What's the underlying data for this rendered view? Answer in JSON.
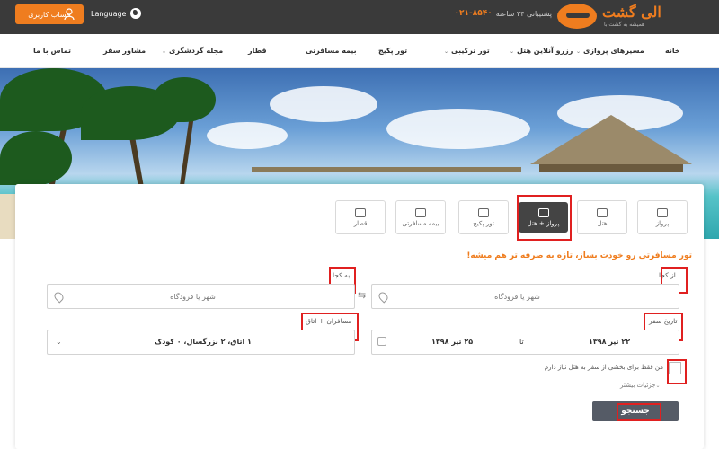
{
  "header": {
    "account_label": "حساب کاربری",
    "language_label": "Language",
    "support_label": "پشتیبانی ۲۴ ساعته",
    "phone": "۰۲۱-۸۵۴۰",
    "logo_name": "الی گشت",
    "logo_slogan": "همیشه به گشت با",
    "accent_color": "#ef7d1f",
    "bar_color": "#3a3a3a"
  },
  "nav": {
    "items": [
      {
        "label": "خانه"
      },
      {
        "label": "مسیرهای پروازی"
      },
      {
        "label": "رزرو آنلاین هتل"
      },
      {
        "label": "تور ترکیبی"
      },
      {
        "label": "تور پکیج"
      },
      {
        "label": "بیمه مسافرتی"
      },
      {
        "label": "قطار"
      },
      {
        "label": "مجله گردشگری"
      },
      {
        "label": "مشاور سفر"
      },
      {
        "label": "تماس با ما"
      }
    ]
  },
  "tabs": [
    {
      "label": "پرواز",
      "icon": "plane-icon"
    },
    {
      "label": "هتل",
      "icon": "hotel-icon"
    },
    {
      "label": "پرواز + هتل",
      "icon": "plane-hotel-icon",
      "active": true
    },
    {
      "label": "تور پکیج",
      "icon": "package-icon"
    },
    {
      "label": "بیمه مسافرتی",
      "icon": "umbrella-icon"
    },
    {
      "label": "قطار",
      "icon": "train-icon"
    }
  ],
  "form": {
    "promo": "تور مسافرتی رو خودت بساز، تازه به صرفه تر هم میشه!",
    "origin_label": "از کجا",
    "origin_placeholder": "شهر یا فرودگاه",
    "destination_label": "به کجا",
    "destination_placeholder": "شهر یا فرودگاه",
    "date_label": "تاریخ سفر",
    "date_from": "۲۲ تیر ۱۳۹۸",
    "date_to_word": "تا",
    "date_to": "۲۵ تیر ۱۳۹۸",
    "passengers_label": "مسافران + اتاق",
    "passengers_value": "۱ اتاق، ۲ بزرگسال، ۰ کودک",
    "partial_hotel_label": "من فقط برای بخشی از سفر به هتل نیاز دارم",
    "more_details": "جزئیات بیشتر",
    "search_button": "جستجو"
  }
}
